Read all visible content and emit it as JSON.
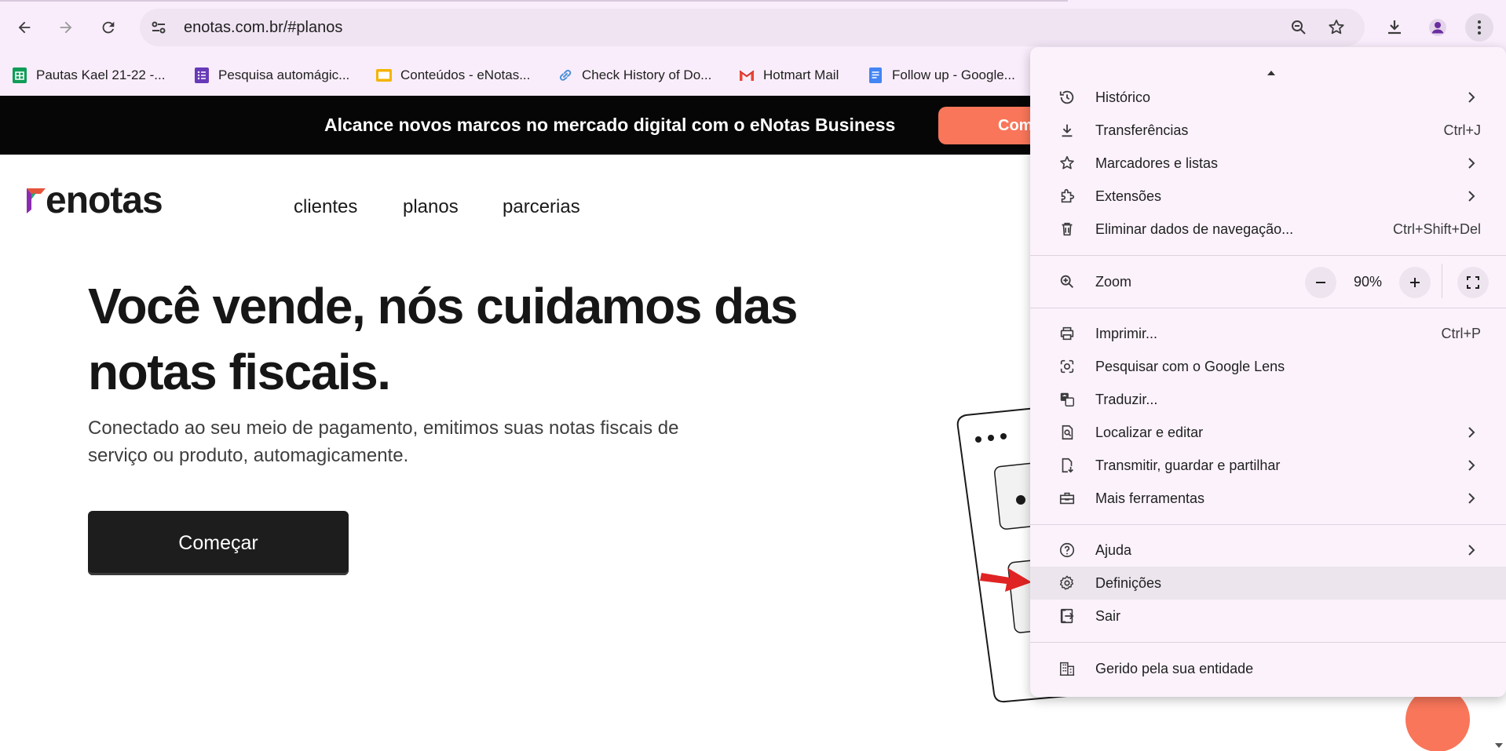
{
  "browser": {
    "url": "enotas.com.br/#planos"
  },
  "bookmarks": [
    {
      "label": "Pautas Kael 21-22 -...",
      "icon": "sheets-icon",
      "color": "#0f9d58"
    },
    {
      "label": "Pesquisa automágic...",
      "icon": "forms-icon",
      "color": "#673ab7"
    },
    {
      "label": "Conteúdos - eNotas...",
      "icon": "slides-icon",
      "color": "#f4b400"
    },
    {
      "label": "Check History of Do...",
      "icon": "link-icon",
      "color": "#4a90d9"
    },
    {
      "label": "Hotmart Mail",
      "icon": "gmail-icon",
      "color": "#ea4335"
    },
    {
      "label": "Follow up - Google...",
      "icon": "docs-icon",
      "color": "#4285f4"
    }
  ],
  "page": {
    "banner_text": "Alcance novos marcos no mercado digital com o eNotas Business",
    "banner_cta": "Com",
    "logo": "enotas",
    "nav": [
      "clientes",
      "planos",
      "parcerias"
    ],
    "hero_title": "Você vende, nós cuidamos das notas fiscais.",
    "hero_subtitle": "Conectado ao seu meio de pagamento, emitimos suas notas fiscais de serviço ou produto, automagicamente.",
    "cta": "Começar"
  },
  "menu": {
    "items": [
      {
        "label": "Histórico",
        "icon": "history-icon",
        "shortcut": "",
        "submenu": true
      },
      {
        "label": "Transferências",
        "icon": "download-icon",
        "shortcut": "Ctrl+J",
        "submenu": false
      },
      {
        "label": "Marcadores e listas",
        "icon": "star-icon",
        "shortcut": "",
        "submenu": true
      },
      {
        "label": "Extensões",
        "icon": "puzzle-icon",
        "shortcut": "",
        "submenu": true
      },
      {
        "label": "Eliminar dados de navegação...",
        "icon": "trash-icon",
        "shortcut": "Ctrl+Shift+Del",
        "submenu": false
      }
    ],
    "zoom": {
      "label": "Zoom",
      "value": "90%",
      "minus": "−",
      "plus": "+"
    },
    "items2": [
      {
        "label": "Imprimir...",
        "icon": "print-icon",
        "shortcut": "Ctrl+P",
        "submenu": false
      },
      {
        "label": "Pesquisar com o Google Lens",
        "icon": "lens-icon",
        "shortcut": "",
        "submenu": false
      },
      {
        "label": "Traduzir...",
        "icon": "translate-icon",
        "shortcut": "",
        "submenu": false
      },
      {
        "label": "Localizar e editar",
        "icon": "find-icon",
        "shortcut": "",
        "submenu": true
      },
      {
        "label": "Transmitir, guardar e partilhar",
        "icon": "cast-save-icon",
        "shortcut": "",
        "submenu": true
      },
      {
        "label": "Mais ferramentas",
        "icon": "toolbox-icon",
        "shortcut": "",
        "submenu": true
      }
    ],
    "items3": [
      {
        "label": "Ajuda",
        "icon": "help-icon",
        "submenu": true
      },
      {
        "label": "Definições",
        "icon": "settings-icon",
        "submenu": false
      },
      {
        "label": "Sair",
        "icon": "exit-icon",
        "submenu": false
      }
    ],
    "managed": {
      "label": "Gerido pela sua entidade",
      "icon": "building-icon"
    }
  }
}
